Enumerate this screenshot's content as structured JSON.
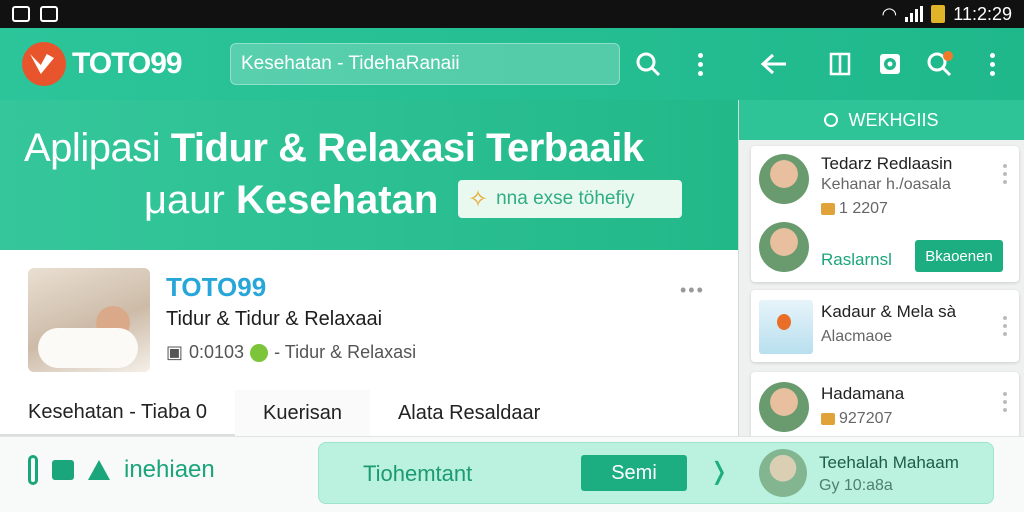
{
  "status_bar": {
    "time": "11:2:29",
    "icons": [
      "image-icon",
      "app-icon",
      "wifi-icon",
      "signal-icon",
      "battery-icon"
    ]
  },
  "app_bar": {
    "logo_text": "TOTO99",
    "search_value": "Kesehatan - TidehaRanaii",
    "icons": [
      "search-icon",
      "more-icon",
      "back-icon",
      "book-icon",
      "puzzle-icon",
      "notification-search-icon",
      "more-icon"
    ]
  },
  "hero": {
    "line1_prefix": "Aplipasi",
    "line1_bold": "Tidur & Relaxasi Terbaaik",
    "line2_prefix": "μaur",
    "line2_bold": "Kesehatan",
    "pill_text": "nna exse töhefiy"
  },
  "card": {
    "title": "TOTO99",
    "subtitle": "Tidur & Tidur & Relaxaai",
    "meta_value": "0:0103",
    "meta_label": "- Tidur & Relaxasi"
  },
  "tabs": [
    {
      "label": "Kesehatan - Tiaba 0"
    },
    {
      "label": "Kuerisan"
    },
    {
      "label": "Alata Resaldaar"
    }
  ],
  "bottom_bar": {
    "left_label": "inehiaen"
  },
  "floating_panel": {
    "text": "Tiohemtant",
    "button_label": "Semi"
  },
  "right_panel": {
    "header": "WEKHGIIS",
    "items": [
      {
        "title": "Tedarz Redlaasin",
        "subtitle": "Kehanar h./oasala",
        "meta": "1 2207",
        "label": "Raslarnsl",
        "button": "Bkaoenen"
      },
      {
        "title": "Kadaur & Mela sà",
        "subtitle": "Alacmaoe"
      },
      {
        "title": "Hadamana",
        "meta": "927207"
      },
      {
        "title": "Teehalah Mahaam",
        "meta": "Gy 10:a8a"
      }
    ]
  },
  "colors": {
    "primary": "#22b888",
    "accent_blue": "#27a6d9",
    "status_bar": "#111111"
  }
}
